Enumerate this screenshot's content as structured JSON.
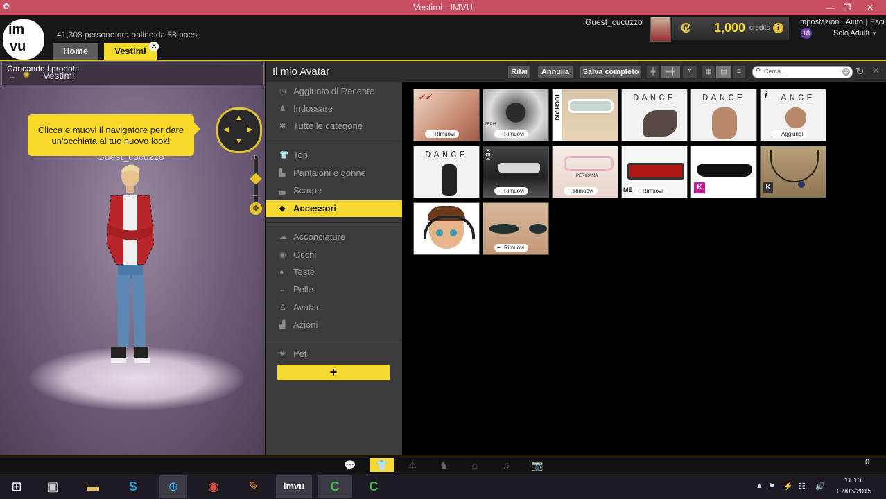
{
  "window": {
    "title": "Vestimi - IMVU"
  },
  "header": {
    "online_text": "41,308 persone ora online da 88 paesi",
    "tabs": [
      {
        "label": "Home"
      },
      {
        "label": "Vestimi"
      }
    ],
    "username": "Guest_cucuzzo",
    "credits": {
      "amount": "1,000",
      "label": "credits",
      "icon": "credit-icon"
    },
    "links": [
      "Impostazioni",
      "|",
      "Aiuto",
      "|",
      "Esci"
    ],
    "age_badge": "18",
    "solo_adulti": "Solo Adulti"
  },
  "avatar_pane": {
    "loading_text": "Caricando i prodotti",
    "panel_label": "Vestimi",
    "tooltip": "Clicca e muovi il navigatore per dare un'occhiata al tuo nuovo look!",
    "guest_name": "Guest_cucuzzo"
  },
  "toolbar": {
    "title": "Il mio Avatar",
    "buttons": [
      "Rifai",
      "Annulla",
      "Salva completo"
    ],
    "search_placeholder": "Cerca..."
  },
  "categories": [
    {
      "label": "Aggiunto di Recente",
      "icon": "clock-icon"
    },
    {
      "label": "Indossare",
      "icon": "figure-icon"
    },
    {
      "label": "Tutte le categorie",
      "icon": "asterisk-icon"
    },
    {
      "label": "Top",
      "icon": "shirt-icon"
    },
    {
      "label": "Pantaloni e gonne",
      "icon": "pants-icon"
    },
    {
      "label": "Scarpe",
      "icon": "shoe-icon"
    },
    {
      "label": "Accessori",
      "icon": "gem-icon",
      "active": true
    },
    {
      "label": "Acconciature",
      "icon": "hair-icon"
    },
    {
      "label": "Occhi",
      "icon": "eye-icon"
    },
    {
      "label": "Teste",
      "icon": "head-icon"
    },
    {
      "label": "Pelle",
      "icon": "skin-icon"
    },
    {
      "label": "Avatar",
      "icon": "avatar-icon"
    },
    {
      "label": "Azioni",
      "icon": "action-icon"
    },
    {
      "label": "Pet",
      "icon": "paw-icon"
    }
  ],
  "add_button": "+",
  "items": [
    {
      "caption": "Rimuovi"
    },
    {
      "caption": "Rimuovi",
      "text": "ZEPH"
    },
    {
      "text": "TOCHIAKI"
    },
    {
      "text": "DANCE"
    },
    {
      "text": "DANCE"
    },
    {
      "caption": "Aggiungi",
      "text": "ANCE"
    },
    {
      "text": "DANCE"
    },
    {
      "caption": "Rimuovi",
      "text": "KEN"
    },
    {
      "caption": "Rimuovi",
      "text": "PERIRAMA"
    },
    {
      "caption": "Rimuovi",
      "text": "ME"
    },
    {
      "text": "K"
    },
    {
      "text": "K"
    },
    {
      "text": ""
    },
    {
      "caption": "Rimuovi"
    }
  ],
  "bottom": {
    "count": "0"
  },
  "taskbar": {
    "time": "11.10",
    "date": "07/06/2015"
  }
}
